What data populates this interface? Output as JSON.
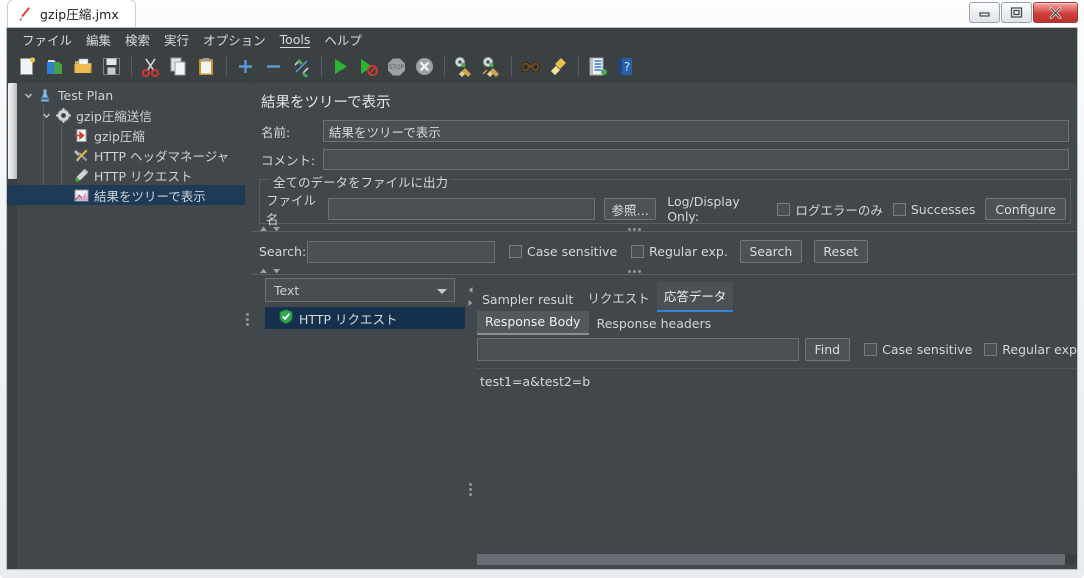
{
  "window": {
    "title": "gzip圧縮.jmx",
    "app_icon": "jmeter-feather-icon",
    "controls": {
      "minimize": "minimize-button",
      "maximize": "maximize-button",
      "close": "close-button"
    }
  },
  "menubar": {
    "items": [
      {
        "label": "ファイル"
      },
      {
        "label": "編集"
      },
      {
        "label": "検索"
      },
      {
        "label": "実行"
      },
      {
        "label": "オプション"
      },
      {
        "label": "Tools",
        "mnemonic": "T"
      },
      {
        "label": "ヘルプ"
      }
    ]
  },
  "toolbar": {
    "items": [
      {
        "name": "new-icon"
      },
      {
        "name": "templates-icon"
      },
      {
        "name": "open-icon"
      },
      {
        "name": "save-icon"
      },
      {
        "sep": true
      },
      {
        "name": "cut-icon"
      },
      {
        "name": "copy-icon"
      },
      {
        "name": "paste-icon"
      },
      {
        "sep": true
      },
      {
        "name": "expand-all-icon"
      },
      {
        "name": "collapse-all-icon"
      },
      {
        "name": "toggle-icon"
      },
      {
        "sep": true
      },
      {
        "name": "start-icon"
      },
      {
        "name": "start-no-timers-icon"
      },
      {
        "name": "stop-icon"
      },
      {
        "name": "shutdown-icon"
      },
      {
        "sep": true
      },
      {
        "name": "clear-icon"
      },
      {
        "name": "clear-all-icon"
      },
      {
        "sep": true
      },
      {
        "name": "search-icon"
      },
      {
        "name": "search-reset-icon"
      },
      {
        "sep": true
      },
      {
        "name": "function-helper-icon"
      },
      {
        "name": "help-icon"
      }
    ]
  },
  "tree": {
    "nodes": [
      {
        "label": "Test Plan",
        "icon": "test-plan-icon",
        "depth": 0,
        "expanded": true,
        "selected": false
      },
      {
        "label": "gzip圧縮送信",
        "icon": "thread-group-icon",
        "depth": 1,
        "expanded": true,
        "selected": false
      },
      {
        "label": "gzip圧縮",
        "icon": "preprocessor-icon",
        "depth": 2,
        "expanded": null,
        "selected": false
      },
      {
        "label": "HTTP ヘッダマネージャ",
        "icon": "header-manager-icon",
        "depth": 2,
        "expanded": null,
        "selected": false
      },
      {
        "label": "HTTP リクエスト",
        "icon": "http-request-icon",
        "depth": 2,
        "expanded": null,
        "selected": false
      },
      {
        "label": "結果をツリーで表示",
        "icon": "view-results-tree-icon",
        "depth": 2,
        "expanded": null,
        "selected": true
      }
    ]
  },
  "panel": {
    "title": "結果をツリーで表示",
    "name_label": "名前:",
    "name_value": "結果をツリーで表示",
    "comment_label": "コメント:",
    "comment_value": "",
    "file_group": {
      "legend": "全てのデータをファイルに出力",
      "filename_label": "ファイル名",
      "filename_value": "",
      "browse_button": "参照…",
      "log_display_label": "Log/Display Only:",
      "errors_only_checkbox": "ログエラーのみ",
      "errors_only_checked": false,
      "successes_checkbox": "Successes",
      "successes_checked": false,
      "configure_button": "Configure"
    },
    "search_row": {
      "label": "Search:",
      "value": "",
      "case_sensitive_label": "Case sensitive",
      "case_sensitive_checked": false,
      "regex_label": "Regular exp.",
      "regex_checked": false,
      "search_button": "Search",
      "reset_button": "Reset"
    },
    "renderer_combo": {
      "value": "Text",
      "chevron": "chevron-down-icon"
    },
    "results_tree": {
      "items": [
        {
          "label": "HTTP リクエスト",
          "icon": "success-shield-icon",
          "selected": true
        }
      ]
    },
    "result_tabs": [
      {
        "label": "Sampler result",
        "active": false
      },
      {
        "label": "リクエスト",
        "active": false
      },
      {
        "label": "応答データ",
        "active": true
      }
    ],
    "response_tabs": [
      {
        "label": "Response Body",
        "active": true
      },
      {
        "label": "Response headers",
        "active": false
      }
    ],
    "find_row": {
      "value": "",
      "find_button": "Find",
      "case_sensitive_label": "Case sensitive",
      "case_sensitive_checked": false,
      "regex_label": "Regular exp",
      "regex_checked": false
    },
    "response_body": "test1=a&test2=b"
  },
  "colors": {
    "app_bg": "#42474c",
    "toolbar_bg": "#3b4043",
    "tree_selection": "#1d3a57",
    "results_selection": "#14304d",
    "accent_tab": "#2e86de",
    "text": "#d6d8da"
  }
}
